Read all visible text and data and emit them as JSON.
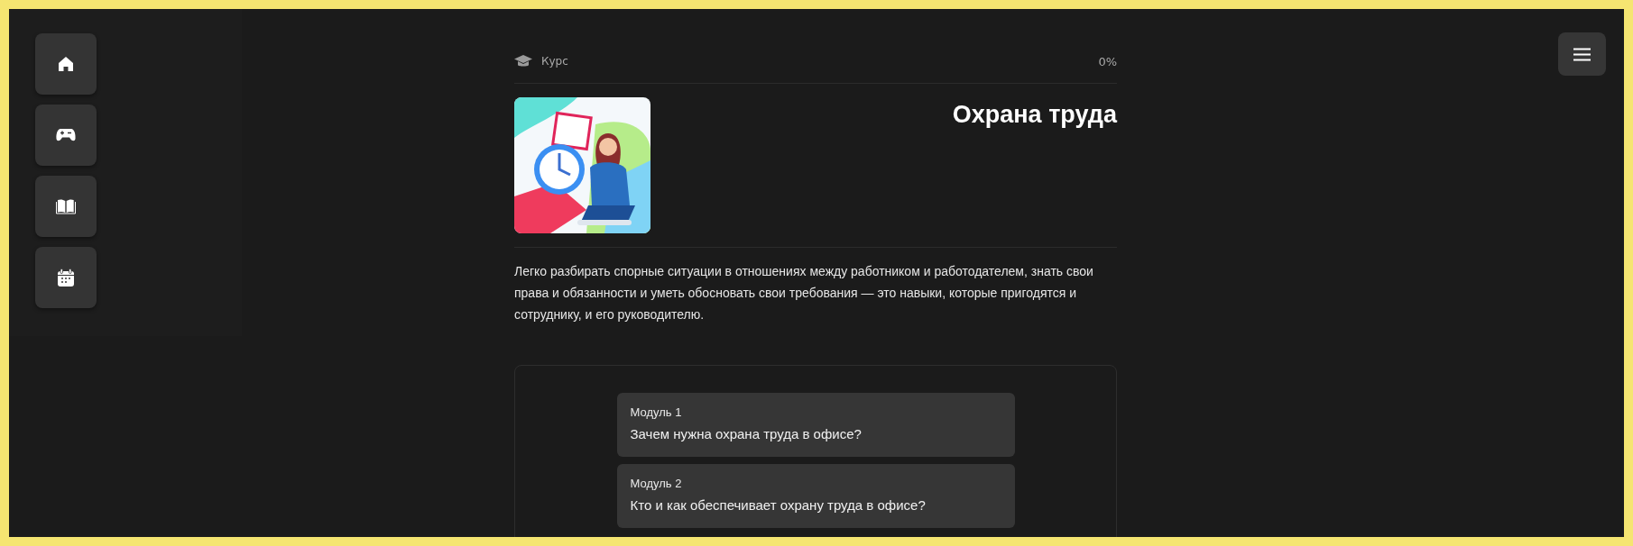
{
  "sidebar": {
    "items": [
      {
        "kind": "home"
      },
      {
        "kind": "gamepad"
      },
      {
        "kind": "book"
      },
      {
        "kind": "calendar"
      }
    ]
  },
  "course": {
    "label": "Курс",
    "progress": "0%",
    "title": "Охрана труда",
    "description": "Легко разбирать спорные ситуации в отношениях между работником и работодателем, знать свои права и обязанности и уметь обосновать свои требования — это навыки, которые пригодятся и сотруднику, и его руководителю."
  },
  "modules": [
    {
      "number": "Модуль 1",
      "title": "Зачем нужна охрана труда в офисе?"
    },
    {
      "number": "Модуль 2",
      "title": "Кто и как обеспечивает охрану труда в офисе?"
    }
  ]
}
